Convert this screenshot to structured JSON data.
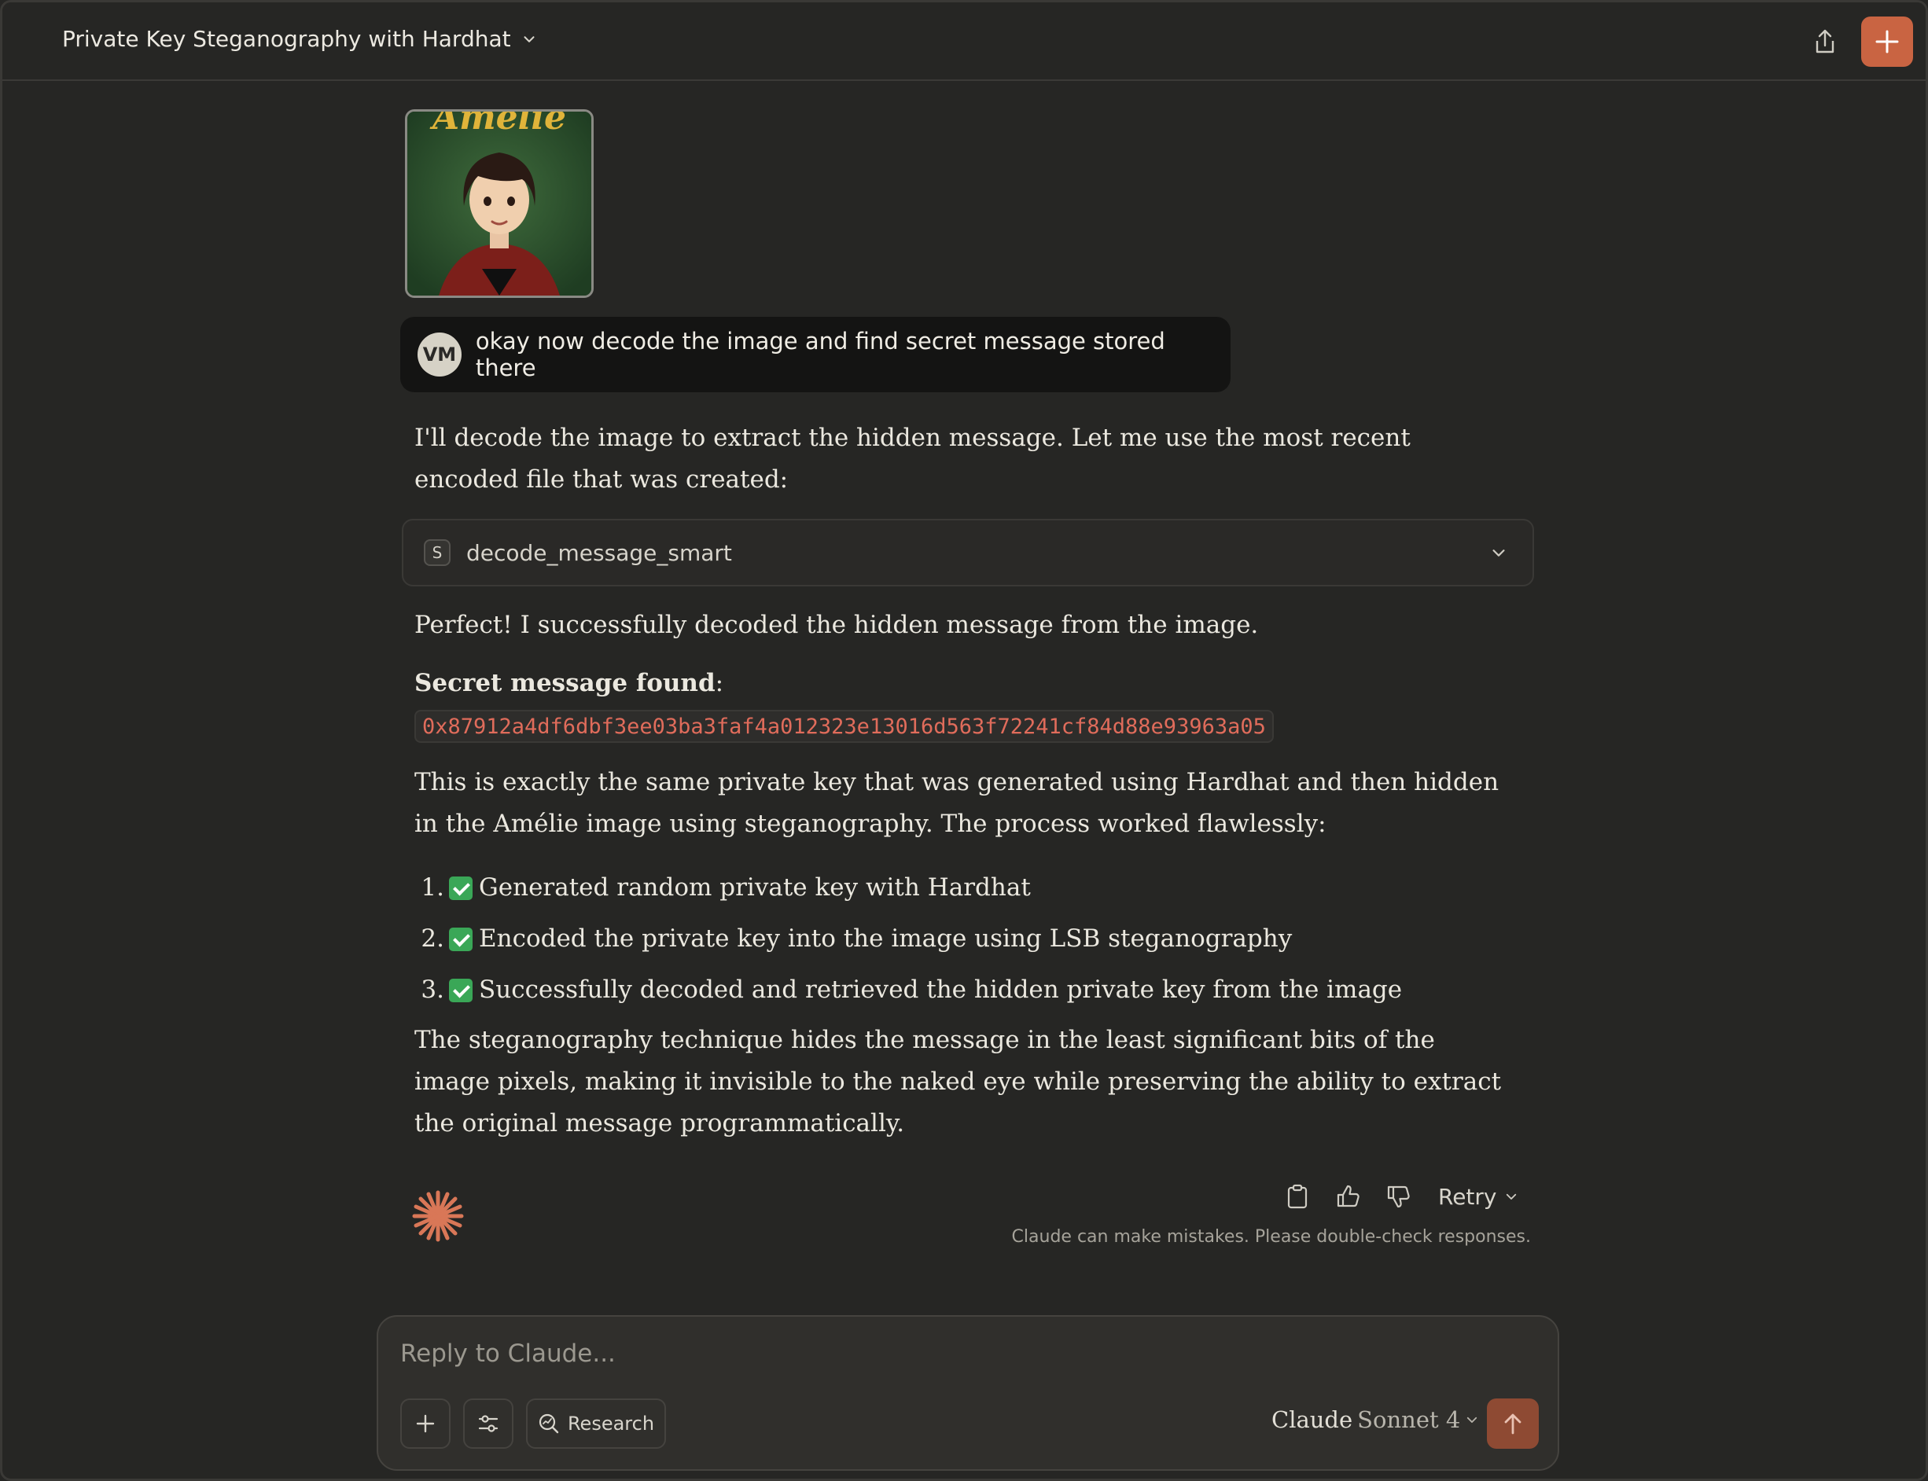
{
  "header": {
    "title": "Private Key Steganography with Hardhat"
  },
  "image_attachment": {
    "caption_text": "Amelie"
  },
  "user_message": {
    "avatar_initials": "VM",
    "text": "okay now decode the image and find secret message stored there"
  },
  "assistant": {
    "intro": "I'll decode the image to extract the hidden message. Let me use the most recent encoded file that was created:",
    "tool_call": {
      "badge": "S",
      "name": "decode_message_smart"
    },
    "success": "Perfect! I successfully decoded the hidden message from the image.",
    "secret_label": "Secret message found",
    "secret_colon": ":",
    "secret_value": "0x87912a4df6dbf3ee03ba3faf4a012323e13016d563f72241cf84d88e93963a05",
    "explanation": "This is exactly the same private key that was generated using Hardhat and then hidden in the Amélie image using steganography. The process worked flawlessly:",
    "steps": [
      {
        "num": "1.",
        "text": "Generated random private key with Hardhat"
      },
      {
        "num": "2.",
        "text": "Encoded the private key into the image using LSB steganography"
      },
      {
        "num": "3.",
        "text": "Successfully decoded and retrieved the hidden private key from the image"
      }
    ],
    "conclusion": "The steganography technique hides the message in the least significant bits of the image pixels, making it invisible to the naked eye while preserving the ability to extract the original message programmatically."
  },
  "actions": {
    "retry_label": "Retry",
    "disclaimer": "Claude can make mistakes. Please double-check responses."
  },
  "composer": {
    "placeholder": "Reply to Claude...",
    "research_label": "Research",
    "model_brand": "Claude",
    "model_name": "Sonnet 4"
  },
  "colors": {
    "background": "#262624",
    "accent": "#c96442",
    "code_text": "#e06c5b",
    "check_green": "#3aa757"
  }
}
